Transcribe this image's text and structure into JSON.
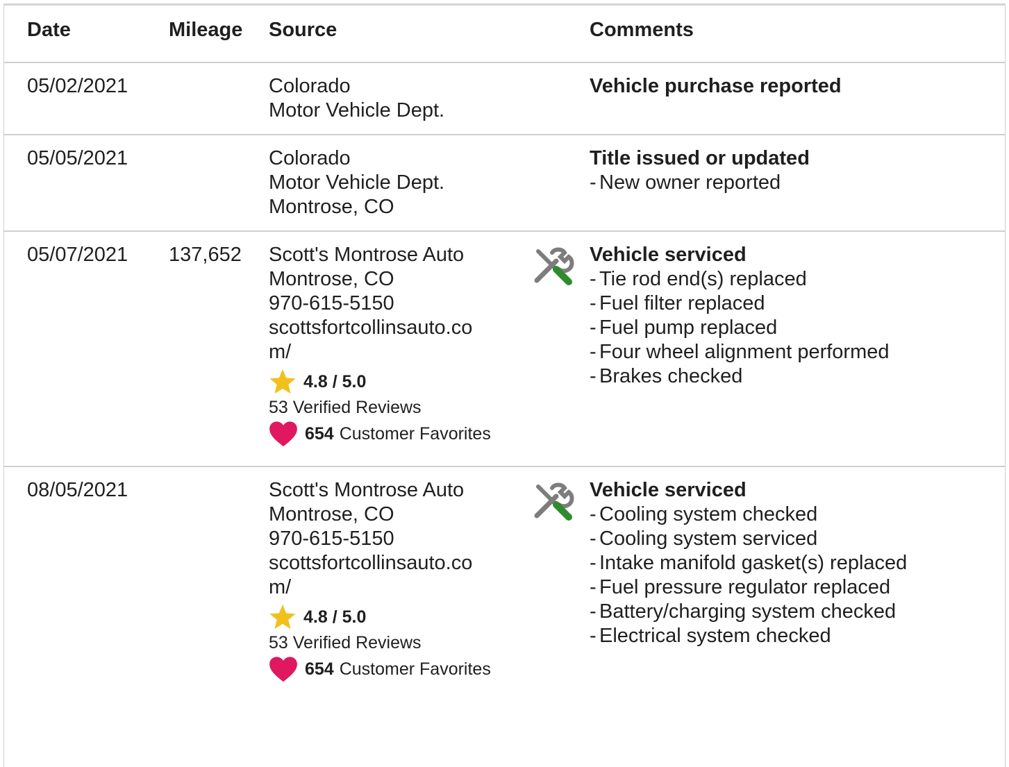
{
  "headers": {
    "date": "Date",
    "mileage": "Mileage",
    "source": "Source",
    "comments": "Comments"
  },
  "colors": {
    "star": "#f2c01c",
    "heart": "#e0185f",
    "wrench_gray": "#7d7d7d",
    "screwdriver_green": "#2e8b2e",
    "border": "#cfcfcf"
  },
  "rows": [
    {
      "date": "05/02/2021",
      "mileage": "",
      "source": [
        "Colorado",
        "Motor Vehicle Dept."
      ],
      "comment_title": "Vehicle purchase reported",
      "comment_items": []
    },
    {
      "date": "05/05/2021",
      "mileage": "",
      "source": [
        "Colorado",
        "Motor Vehicle Dept.",
        "Montrose, CO"
      ],
      "comment_title": "Title issued or updated",
      "comment_items": [
        "New owner reported"
      ]
    },
    {
      "date": "05/07/2021",
      "mileage": "137,652",
      "source": [
        "Scott's Montrose Auto",
        "Montrose, CO",
        "970-615-5150",
        "scottsfortcollinsauto.co",
        "m/"
      ],
      "icon": "service-tools-icon",
      "rating": "4.8 / 5.0",
      "reviews": "53 Verified Reviews",
      "favorites_count": "654",
      "favorites_label": "Customer Favorites",
      "comment_title": "Vehicle serviced",
      "comment_items": [
        "Tie rod end(s) replaced",
        "Fuel filter replaced",
        "Fuel pump replaced",
        "Four wheel alignment performed",
        "Brakes checked"
      ]
    },
    {
      "date": "08/05/2021",
      "mileage": "",
      "source": [
        "Scott's Montrose Auto",
        "Montrose, CO",
        "970-615-5150",
        "scottsfortcollinsauto.co",
        "m/"
      ],
      "icon": "service-tools-icon",
      "rating": "4.8 / 5.0",
      "reviews": "53 Verified Reviews",
      "favorites_count": "654",
      "favorites_label": "Customer Favorites",
      "comment_title": "Vehicle serviced",
      "comment_items": [
        "Cooling system checked",
        "Cooling system serviced",
        "Intake manifold gasket(s) replaced",
        "Fuel pressure regulator replaced",
        "Battery/charging system checked",
        "Electrical system checked"
      ]
    }
  ]
}
